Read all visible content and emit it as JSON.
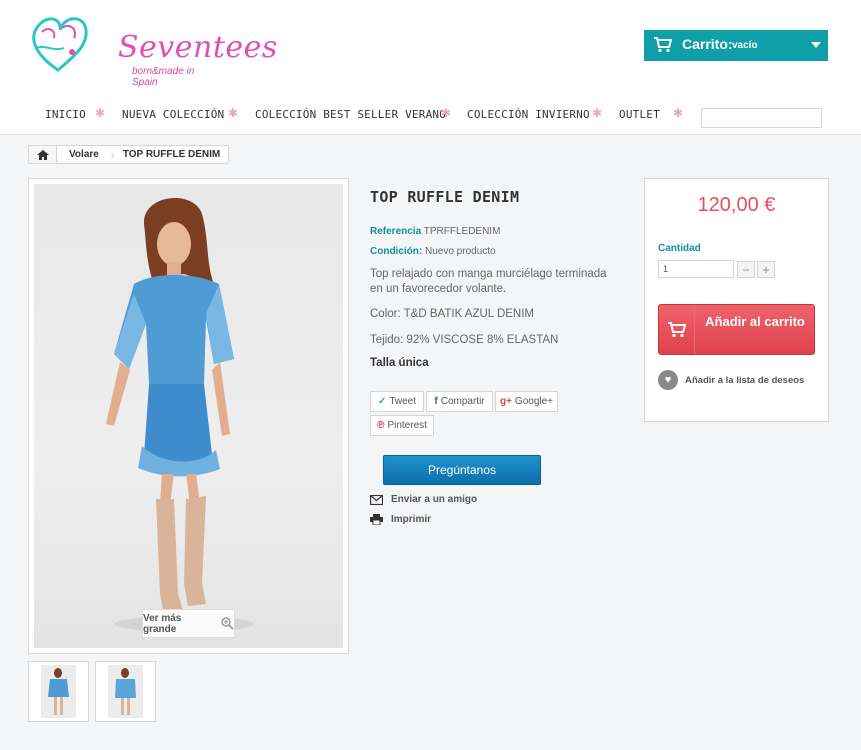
{
  "logo": {
    "brand": "Seventees",
    "tagline": "born&made in Spain"
  },
  "cart": {
    "label": "Carrito:",
    "status": "vacío"
  },
  "nav": {
    "items": [
      "INICIO",
      "NUEVA COLECCIÓN",
      "COLECCIÓN BEST SELLER VERANO",
      "COLECCIÓN INVIERNO",
      "OUTLET"
    ]
  },
  "search": {
    "value": ""
  },
  "breadcrumb": {
    "category": "Volare",
    "current": "TOP RUFFLE DENIM"
  },
  "image": {
    "zoom_label": "Ver más grande"
  },
  "product": {
    "title": "TOP RUFFLE DENIM",
    "reference_label": "Referencia",
    "reference": "TPRFFLEDENIM",
    "condition_label": "Condición:",
    "condition": "Nuevo producto",
    "description": "Top relajado con manga murciélago terminada en un favorecedor volante.",
    "color": "Color: T&D BATIK AZUL DENIM",
    "fabric": "Tejido: 92% VISCOSE 8% ELASTAN",
    "size": "Talla única"
  },
  "social": {
    "tweet": "Tweet",
    "share": "Compartir",
    "google": "Google+",
    "pinterest": "Pinterest"
  },
  "actions": {
    "ask": "Pregúntanos",
    "send_friend": "Enviar a un amigo",
    "print": "Imprimir"
  },
  "buy": {
    "price": "120,00 €",
    "qty_label": "Cantidad",
    "qty_value": "1",
    "add_to_cart": "Añadir al carrito",
    "wishlist": "Añadir a la lista de deseos"
  },
  "colors": {
    "accent": "#0f9fa8",
    "price": "#e2505e",
    "add_cart": "#e8505b",
    "ask": "#1581bd"
  }
}
